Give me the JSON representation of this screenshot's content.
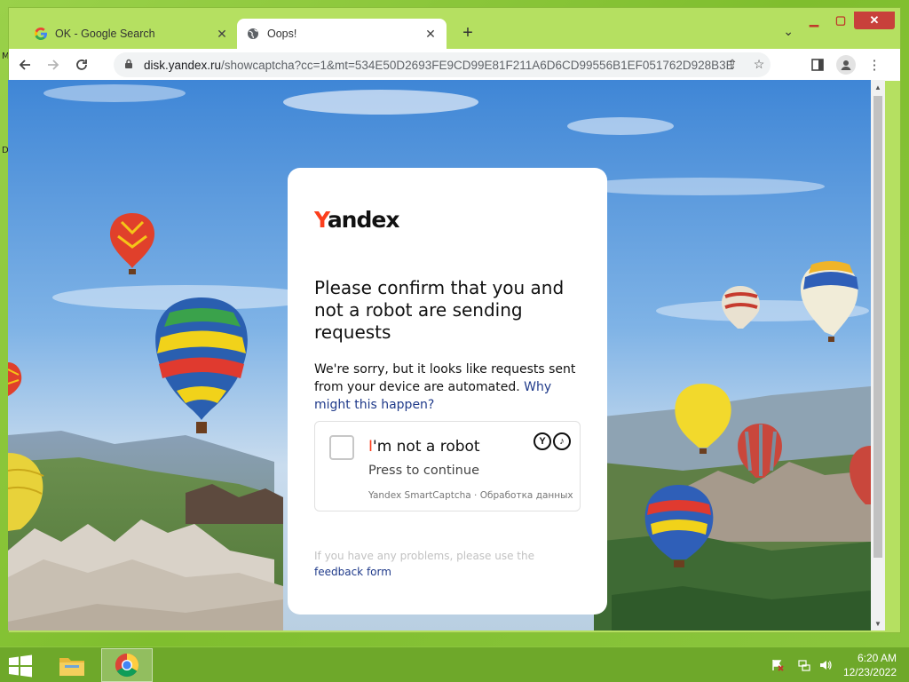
{
  "desktop": {
    "edge_labels": [
      "M",
      "D"
    ]
  },
  "browser": {
    "tabs": [
      {
        "title": "OK - Google Search",
        "icon": "google-g-icon",
        "active": false
      },
      {
        "title": "Oops!",
        "icon": "globe-icon",
        "active": true
      }
    ],
    "url_host": "disk.yandex.ru",
    "url_rest": "/showcaptcha?cc=1&mt=534E50D2693FE9CD99E81F211A6D6CD99556B1EF051762D928B3E...",
    "accent_color": "#b5e061"
  },
  "captcha": {
    "logo_first": "Y",
    "logo_rest": "andex",
    "heading": "Please confirm that you and not a robot are sending requests",
    "description": "We're sorry, but it looks like requests sent from your device are automated.",
    "why_link": "Why might this happen?",
    "checkbox_title_first": "I",
    "checkbox_title_rest": "'m not a robot",
    "checkbox_subtitle": "Press to continue",
    "checkbox_footer": "Yandex SmartCaptcha · Обработка данных",
    "problems_text": "If you have any problems, please use the",
    "feedback_link": "feedback form",
    "brand_color": "#fc3f1d",
    "link_color": "#1f3a8a"
  },
  "taskbar": {
    "time": "6:20 AM",
    "date": "12/23/2022"
  }
}
